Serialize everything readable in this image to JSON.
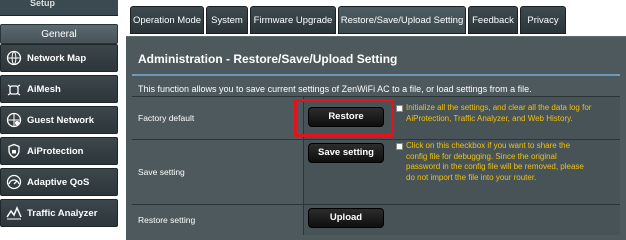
{
  "sidebar": {
    "cut_label": "Setup",
    "section_header": "General",
    "items": [
      {
        "label": "Network Map",
        "icon": "network-map-icon"
      },
      {
        "label": "AiMesh",
        "icon": "aimesh-icon"
      },
      {
        "label": "Guest Network",
        "icon": "guest-network-icon"
      },
      {
        "label": "AiProtection",
        "icon": "lock-icon"
      },
      {
        "label": "Adaptive QoS",
        "icon": "speedometer-icon"
      },
      {
        "label": "Traffic Analyzer",
        "icon": "traffic-analyzer-icon"
      }
    ]
  },
  "tabs": [
    {
      "label": "Operation Mode"
    },
    {
      "label": "System"
    },
    {
      "label": "Firmware Upgrade"
    },
    {
      "label": "Restore/Save/Upload Setting"
    },
    {
      "label": "Feedback"
    },
    {
      "label": "Privacy"
    }
  ],
  "page": {
    "title": "Administration - Restore/Save/Upload Setting",
    "description": "This function allows you to save current settings of ZenWiFi AC to a file, or load settings from a file."
  },
  "rows": {
    "factory": {
      "label": "Factory default",
      "button": "Restore",
      "note_line1": "Initialize all the settings, and clear all the data log for",
      "note_line2": "AiProtection, Traffic Analyzer, and Web History."
    },
    "save": {
      "label": "Save setting",
      "button": "Save setting",
      "note_line1": "Click on this checkbox if you want to share the",
      "note_line2": "config file for debugging. Since the original",
      "note_line3": "password in the config file will be removed, please",
      "note_line4": "do not import the file into your router."
    },
    "restore": {
      "label": "Restore setting",
      "button": "Upload"
    }
  },
  "colors": {
    "panel": "#4d595d",
    "accent_rule": "#6f9ab7",
    "note": "#f0c20f",
    "highlight": "#e3121b"
  }
}
